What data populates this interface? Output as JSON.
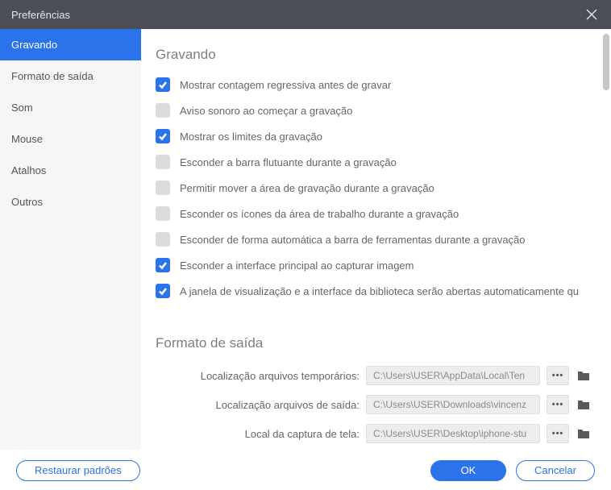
{
  "window": {
    "title": "Preferências"
  },
  "sidebar": {
    "items": [
      {
        "label": "Gravando",
        "active": true
      },
      {
        "label": "Formato de saída",
        "active": false
      },
      {
        "label": "Som",
        "active": false
      },
      {
        "label": "Mouse",
        "active": false
      },
      {
        "label": "Atalhos",
        "active": false
      },
      {
        "label": "Outros",
        "active": false
      }
    ]
  },
  "sections": {
    "recording": {
      "title": "Gravando",
      "options": [
        {
          "label": "Mostrar contagem regressiva antes de gravar",
          "checked": true
        },
        {
          "label": "Aviso sonoro ao começar a gravação",
          "checked": false
        },
        {
          "label": "Mostrar os limites da gravação",
          "checked": true
        },
        {
          "label": "Esconder a barra flutuante durante a gravação",
          "checked": false
        },
        {
          "label": "Permitir mover a área de gravação durante a gravação",
          "checked": false
        },
        {
          "label": "Esconder os ícones da área de trabalho durante a gravação",
          "checked": false
        },
        {
          "label": "Esconder de forma automática a barra de ferramentas durante a gravação",
          "checked": false
        },
        {
          "label": "Esconder a interface principal ao capturar imagem",
          "checked": true
        },
        {
          "label": "A janela de visualização e a interface da biblioteca serão abertas automaticamente qu",
          "checked": true
        }
      ]
    },
    "output": {
      "title": "Formato de saída",
      "rows": [
        {
          "label": "Localização arquivos temporários:",
          "value": "C:\\Users\\USER\\AppData\\Local\\Ten"
        },
        {
          "label": "Localização arquivos de saída:",
          "value": "C:\\Users\\USER\\Downloads\\vincenz"
        },
        {
          "label": "Local da captura de tela:",
          "value": "C:\\Users\\USER\\Desktop\\iphone-stu"
        }
      ],
      "browse_label": "•••"
    }
  },
  "footer": {
    "restore": "Restaurar padrões",
    "ok": "OK",
    "cancel": "Cancelar"
  }
}
